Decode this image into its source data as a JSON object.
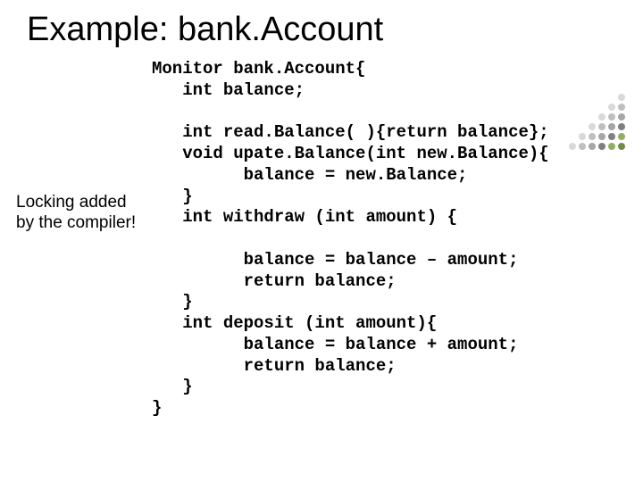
{
  "title": "Example: bank.Account",
  "annotation_l1": "Locking added",
  "annotation_l2": "by the compiler!",
  "code": "Monitor bank.Account{\n   int balance;\n\n   int read.Balance( ){return balance};\n   void upate.Balance(int new.Balance){\n         balance = new.Balance;\n   }\n   int withdraw (int amount) {\n\n         balance = balance – amount;\n         return balance;\n   }\n   int deposit (int amount){\n         balance = balance + amount;\n         return balance;\n   }\n}",
  "motif_colors": [
    "",
    "",
    "",
    "",
    "",
    "",
    "",
    "",
    "",
    "",
    "",
    "",
    "",
    "#d9d9d9",
    "",
    "",
    "",
    "",
    "",
    "#d9d9d9",
    "#bfbfbf",
    "",
    "",
    "",
    "",
    "#d9d9d9",
    "#bfbfbf",
    "#a6a6a6",
    "",
    "",
    "",
    "#d9d9d9",
    "#bfbfbf",
    "#a6a6a6",
    "#7f7f7f",
    "",
    "",
    "#d9d9d9",
    "#bfbfbf",
    "#a6a6a6",
    "#7f7f7f",
    "#8fb060",
    "",
    "#d9d9d9",
    "#bfbfbf",
    "#a6a6a6",
    "#7f7f7f",
    "#8fb060",
    "#6f8f3f"
  ]
}
